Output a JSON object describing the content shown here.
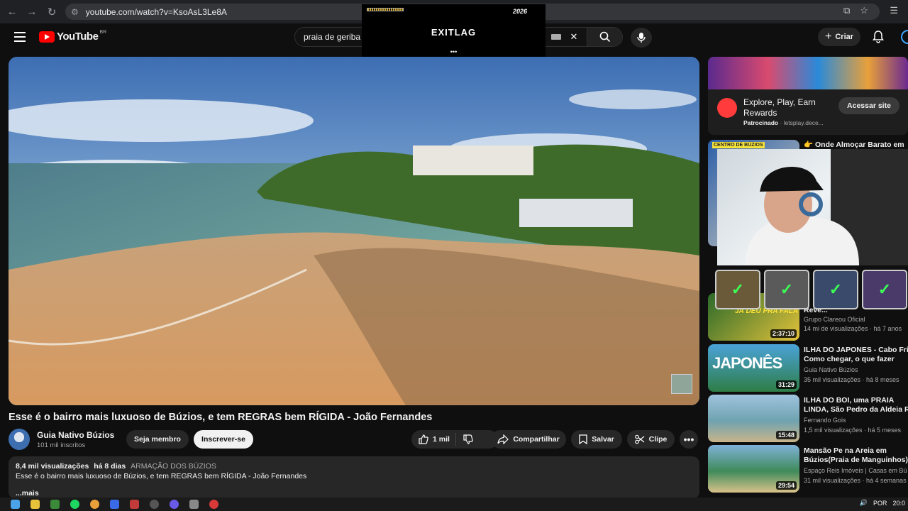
{
  "browser": {
    "url": "youtube.com/watch?v=KsoAsL3Le8A"
  },
  "header": {
    "logo_text": "YouTube",
    "region": "BR",
    "search_value": "praia de geriba",
    "create_label": "Criar"
  },
  "overlay": {
    "brand": "EXITLAG",
    "badge": "2026",
    "dots": "•••"
  },
  "video": {
    "title": "Esse é o bairro mais luxuoso de Búzios, e tem REGRAS bem RÍGIDA - João Fernandes",
    "channel": "Guia Nativo Búzios",
    "subscribers": "101 mil inscritos",
    "join_label": "Seja membro",
    "subscribe_label": "Inscrever-se",
    "likes": "1 mil",
    "share_label": "Compartilhar",
    "save_label": "Salvar",
    "clip_label": "Clipe",
    "more_label": "•••"
  },
  "description": {
    "views": "8,4 mil visualizações",
    "age": "há 8 dias",
    "tags": "ARMAÇÃO DOS BÚZIOS",
    "text": "Esse é o bairro mais luxuoso de Búzios, e tem REGRAS bem RÍGIDA - João Fernandes",
    "more": "...mais"
  },
  "ad": {
    "title": "Explore, Play, Earn Rewards",
    "sponsored": "Patrocinado",
    "domain": "letsplay.dece...",
    "cta": "Acessar site"
  },
  "recommended": [
    {
      "title": "👉 Onde Almoçar Barato em",
      "thumb_text": "CENTRO DE BÚZIOS",
      "channel": "",
      "stats": "",
      "duration": ""
    },
    {
      "title": "Reve...",
      "channel": "Grupo Clareou Oficial",
      "stats": "14 mi de visualizações · há 7 anos",
      "duration": "2:37:10",
      "thumb_text": "JÁ DEU PRA FALA"
    },
    {
      "title": "ILHA DO JAPONES - Cabo Frio",
      "title2": "Como chegar, o que fazer",
      "channel": "Guia Nativo Búzios",
      "stats": "35 mil visualizações · há 8 meses",
      "duration": "31:29",
      "thumb_text": "JAPONÊS"
    },
    {
      "title": "ILHA DO BOI, uma PRAIA",
      "title2": "LINDA, São Pedro da Aldeia RJ",
      "channel": "Fernando Gois",
      "stats": "1,5 mil visualizações · há 5 meses",
      "duration": "15:48"
    },
    {
      "title": "Mansão Pe na Areia em",
      "title2": "Búzios(Praia de Manguinhos)",
      "channel": "Espaço Reis Imóveis | Casas em Bú",
      "stats": "31 mil visualizações · há 4 semanas",
      "duration": "29:54"
    }
  ],
  "taskbar": {
    "lang": "POR",
    "time": "20:0"
  },
  "colors": {
    "background": "#0f0f0f",
    "brand_red": "#ff0000",
    "chip": "#272727",
    "check_green": "#3cff55"
  }
}
